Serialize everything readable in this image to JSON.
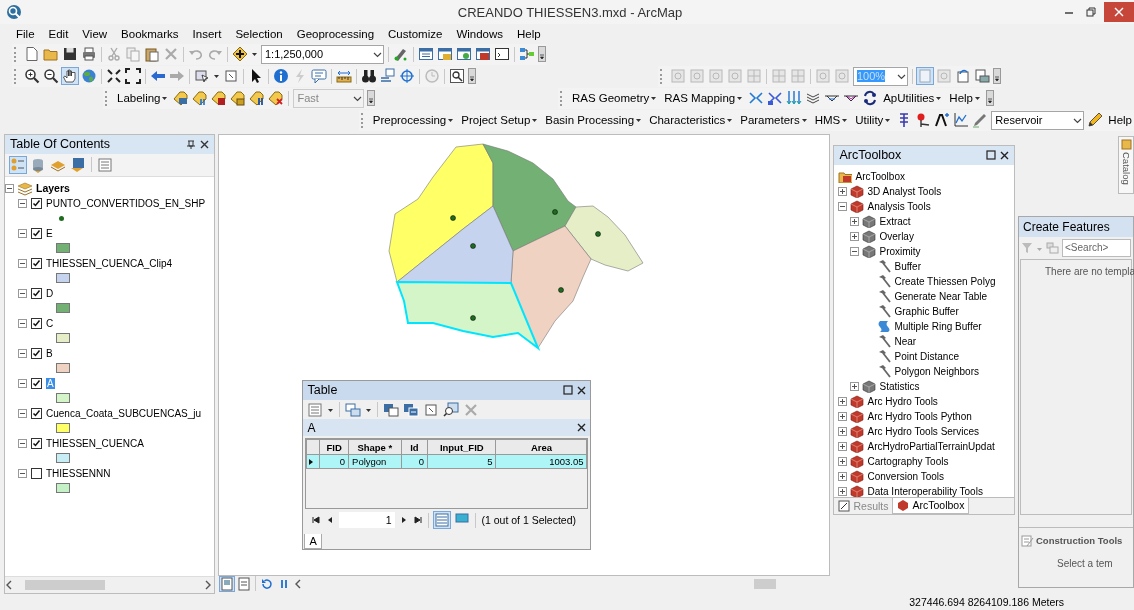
{
  "window": {
    "title": "CREANDO THIESSEN3.mxd - ArcMap"
  },
  "menu": [
    "File",
    "Edit",
    "View",
    "Bookmarks",
    "Insert",
    "Selection",
    "Geoprocessing",
    "Customize",
    "Windows",
    "Help"
  ],
  "standard_toolbar": {
    "scale": "1:1,250,000"
  },
  "layout_toolbar": {
    "zoom": "100%"
  },
  "labeling_toolbar": {
    "label": "Labeling",
    "mode": "Fast"
  },
  "ras_toolbar": {
    "menus_left": [
      "RAS Geometry",
      "RAS Mapping"
    ],
    "menus_right": [
      "ApUtilities",
      "Help"
    ]
  },
  "hms_toolbar": {
    "menus": [
      "Preprocessing",
      "Project Setup",
      "Basin Processing",
      "Characteristics",
      "Parameters",
      "HMS",
      "Utility"
    ],
    "dropdown": "Reservoir",
    "help": "Help"
  },
  "toc": {
    "title": "Table Of Contents",
    "root": "Layers",
    "layers": [
      {
        "name": "PUNTO_CONVERTIDOS_EN_SHP",
        "expanded": true,
        "checked": true,
        "selected": false,
        "kind": "point",
        "color": "#1f6b1f"
      },
      {
        "name": "E",
        "expanded": true,
        "checked": true,
        "selected": false,
        "kind": "fill",
        "color": "#72b073"
      },
      {
        "name": "THIESSEN_CUENCA_Clip4",
        "expanded": true,
        "checked": true,
        "selected": false,
        "kind": "fill",
        "color": "#c6d3ef"
      },
      {
        "name": "D",
        "expanded": true,
        "checked": true,
        "selected": false,
        "kind": "fill",
        "color": "#72b073"
      },
      {
        "name": "C",
        "expanded": true,
        "checked": true,
        "selected": false,
        "kind": "fill",
        "color": "#e6eec8"
      },
      {
        "name": "B",
        "expanded": true,
        "checked": true,
        "selected": false,
        "kind": "fill",
        "color": "#f0d2c2"
      },
      {
        "name": "A",
        "expanded": true,
        "checked": true,
        "selected": true,
        "kind": "fill",
        "color": "#d3f5c8"
      },
      {
        "name": "Cuenca_Coata_SUBCUENCAS_ju",
        "expanded": true,
        "checked": true,
        "selected": false,
        "kind": "fill",
        "color": "#ffff66"
      },
      {
        "name": "THIESSEN_CUENCA",
        "expanded": true,
        "checked": true,
        "selected": false,
        "kind": "fill",
        "color": "#c8eef5"
      },
      {
        "name": "THIESSENNN",
        "expanded": true,
        "checked": false,
        "selected": false,
        "kind": "fill",
        "color": "#c4f2c6"
      }
    ]
  },
  "table": {
    "title": "Table",
    "tab_title": "A",
    "columns": [
      "FID",
      "Shape *",
      "Id",
      "Input_FID",
      "Area"
    ],
    "rows": [
      {
        "selected": true,
        "cells": [
          "0",
          "Polygon",
          "0",
          "5",
          "1003.05"
        ]
      }
    ],
    "record": "1",
    "status": "(1 out of 1 Selected)",
    "tabs": [
      {
        "label": "A",
        "selected": true
      }
    ]
  },
  "arctoolbox": {
    "title": "ArcToolbox",
    "tree": [
      {
        "label": "ArcToolbox",
        "kind": "root",
        "children": [
          {
            "label": "3D Analyst Tools",
            "kind": "toolbox",
            "expanded": false
          },
          {
            "label": "Analysis Tools",
            "kind": "toolbox",
            "expanded": true,
            "children": [
              {
                "label": "Extract",
                "kind": "toolset",
                "expanded": false
              },
              {
                "label": "Overlay",
                "kind": "toolset",
                "expanded": false
              },
              {
                "label": "Proximity",
                "kind": "toolset",
                "expanded": true,
                "children": [
                  {
                    "label": "Buffer",
                    "kind": "tool"
                  },
                  {
                    "label": "Create Thiessen Polyg",
                    "kind": "tool"
                  },
                  {
                    "label": "Generate Near Table",
                    "kind": "tool"
                  },
                  {
                    "label": "Graphic Buffer",
                    "kind": "tool"
                  },
                  {
                    "label": "Multiple Ring Buffer",
                    "kind": "script"
                  },
                  {
                    "label": "Near",
                    "kind": "tool"
                  },
                  {
                    "label": "Point Distance",
                    "kind": "tool"
                  },
                  {
                    "label": "Polygon Neighbors",
                    "kind": "tool"
                  }
                ]
              },
              {
                "label": "Statistics",
                "kind": "toolset",
                "expanded": false
              }
            ]
          },
          {
            "label": "Arc Hydro Tools",
            "kind": "toolbox",
            "expanded": false
          },
          {
            "label": "Arc Hydro Tools Python",
            "kind": "toolbox",
            "expanded": false
          },
          {
            "label": "Arc Hydro Tools Services",
            "kind": "toolbox",
            "expanded": false
          },
          {
            "label": "ArcHydroPartialTerrainUpdat",
            "kind": "toolbox",
            "expanded": false
          },
          {
            "label": "Cartography Tools",
            "kind": "toolbox",
            "expanded": false
          },
          {
            "label": "Conversion Tools",
            "kind": "toolbox",
            "expanded": false
          },
          {
            "label": "Data Interoperability Tools",
            "kind": "toolbox",
            "expanded": false
          }
        ]
      }
    ],
    "tabs": [
      {
        "label": "Results",
        "selected": false
      },
      {
        "label": "ArcToolbox",
        "selected": true
      }
    ]
  },
  "catalog_tab": "Catalog",
  "create_features": {
    "title": "Create Features",
    "placeholder": "<Search>",
    "message": "There are no templa",
    "construction_title": "Construction Tools",
    "construction_message": "Select a tem"
  },
  "status_bar": {
    "coordinates": "327446.694  8264109.186 Meters"
  }
}
